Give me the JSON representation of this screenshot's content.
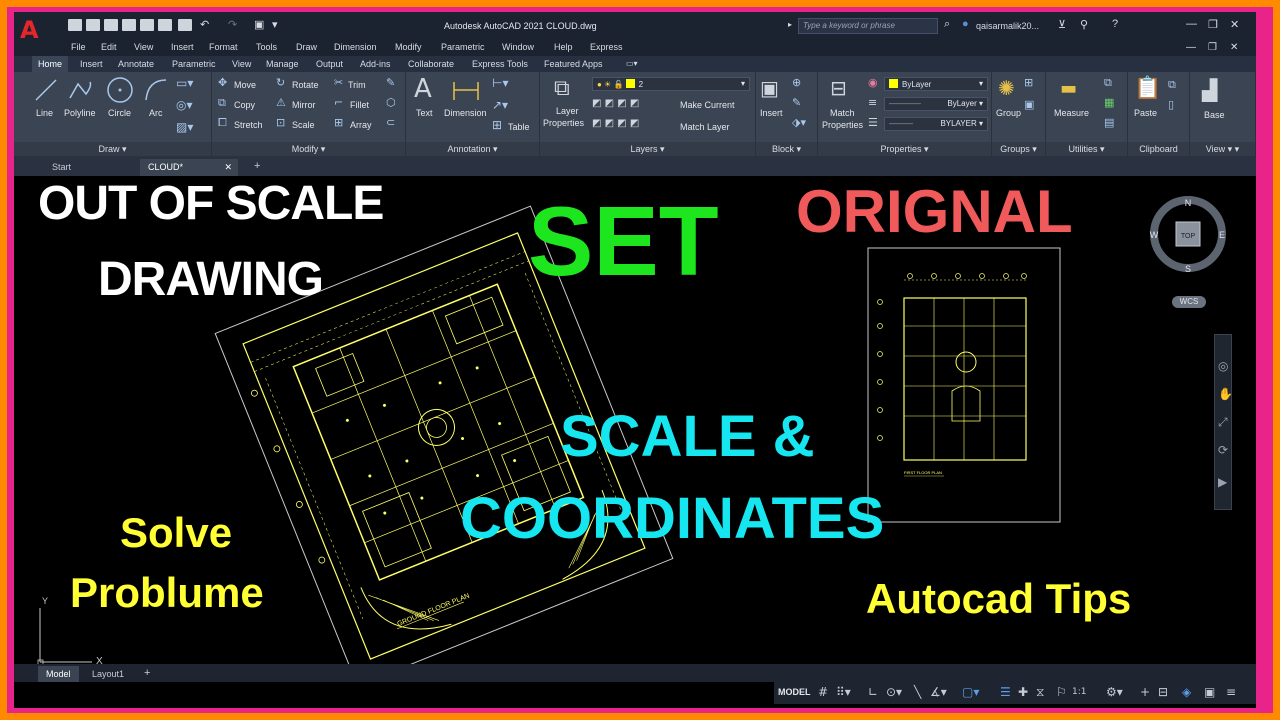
{
  "titlebar": {
    "title": "Autodesk AutoCAD 2021    CLOUD.dwg",
    "search_placeholder": "Type a keyword or phrase",
    "user": "qaisarmalik20..."
  },
  "menu": [
    "File",
    "Edit",
    "View",
    "Insert",
    "Format",
    "Tools",
    "Draw",
    "Dimension",
    "Modify",
    "Parametric",
    "Window",
    "Help",
    "Express"
  ],
  "ribbon_tabs": [
    "Home",
    "Insert",
    "Annotate",
    "Parametric",
    "View",
    "Manage",
    "Output",
    "Add-ins",
    "Collaborate",
    "Express Tools",
    "Featured Apps"
  ],
  "ribbon": {
    "draw": {
      "title": "Draw",
      "tools": [
        "Line",
        "Polyline",
        "Circle",
        "Arc"
      ]
    },
    "modify": {
      "title": "Modify",
      "tools": [
        "Move",
        "Rotate",
        "Trim",
        "Copy",
        "Mirror",
        "Fillet",
        "Stretch",
        "Scale",
        "Array"
      ]
    },
    "annotation": {
      "title": "Annotation",
      "tools": [
        "Text",
        "Dimension",
        "Table"
      ]
    },
    "layers": {
      "title": "Layers",
      "tools": [
        "Layer Properties",
        "Make Current",
        "Match Layer"
      ],
      "current_layer": "2"
    },
    "block": {
      "title": "Block",
      "tools": [
        "Insert"
      ]
    },
    "properties": {
      "title": "Properties",
      "tools": [
        "Match Properties"
      ],
      "color": "ByLayer",
      "linetype": "ByLayer",
      "lineweight": "BYLAYER"
    },
    "groups": {
      "title": "Groups",
      "tools": [
        "Group"
      ]
    },
    "utilities": {
      "title": "Utilities",
      "tools": [
        "Measure"
      ]
    },
    "clipboard": {
      "title": "Clipboard",
      "tools": [
        "Paste"
      ]
    },
    "view": {
      "title": "View",
      "tools": [
        "Base"
      ]
    }
  },
  "file_tabs": [
    "Start",
    "CLOUD*"
  ],
  "viewcube": {
    "n": "N",
    "s": "S",
    "e": "E",
    "w": "W",
    "face": "TOP",
    "wcs": "WCS"
  },
  "ucs": {
    "x": "X",
    "y": "Y"
  },
  "overlay": {
    "out_of_scale_1": "OUT OF SCALE",
    "out_of_scale_2": "DRAWING",
    "set": "SET",
    "original": "ORIGNAL",
    "scale_1": "SCALE &",
    "scale_2": "COORDINATES",
    "solve_1": "Solve",
    "solve_2": "Problume",
    "tips": "Autocad Tips"
  },
  "plan_labels": {
    "ground": "GROUND FLOOR PLAN",
    "first": "FIRST FLOOR PLAN"
  },
  "layout_tabs": [
    "Model",
    "Layout1",
    "+"
  ],
  "status": {
    "model": "MODEL",
    "scale": "1:1"
  },
  "colors": {
    "plan": "#ffff66",
    "set": "#1ee61e",
    "original": "#f05a5a",
    "scale": "#16e6f0",
    "yellow_text": "#ffff33",
    "white_text": "#ffffff"
  }
}
